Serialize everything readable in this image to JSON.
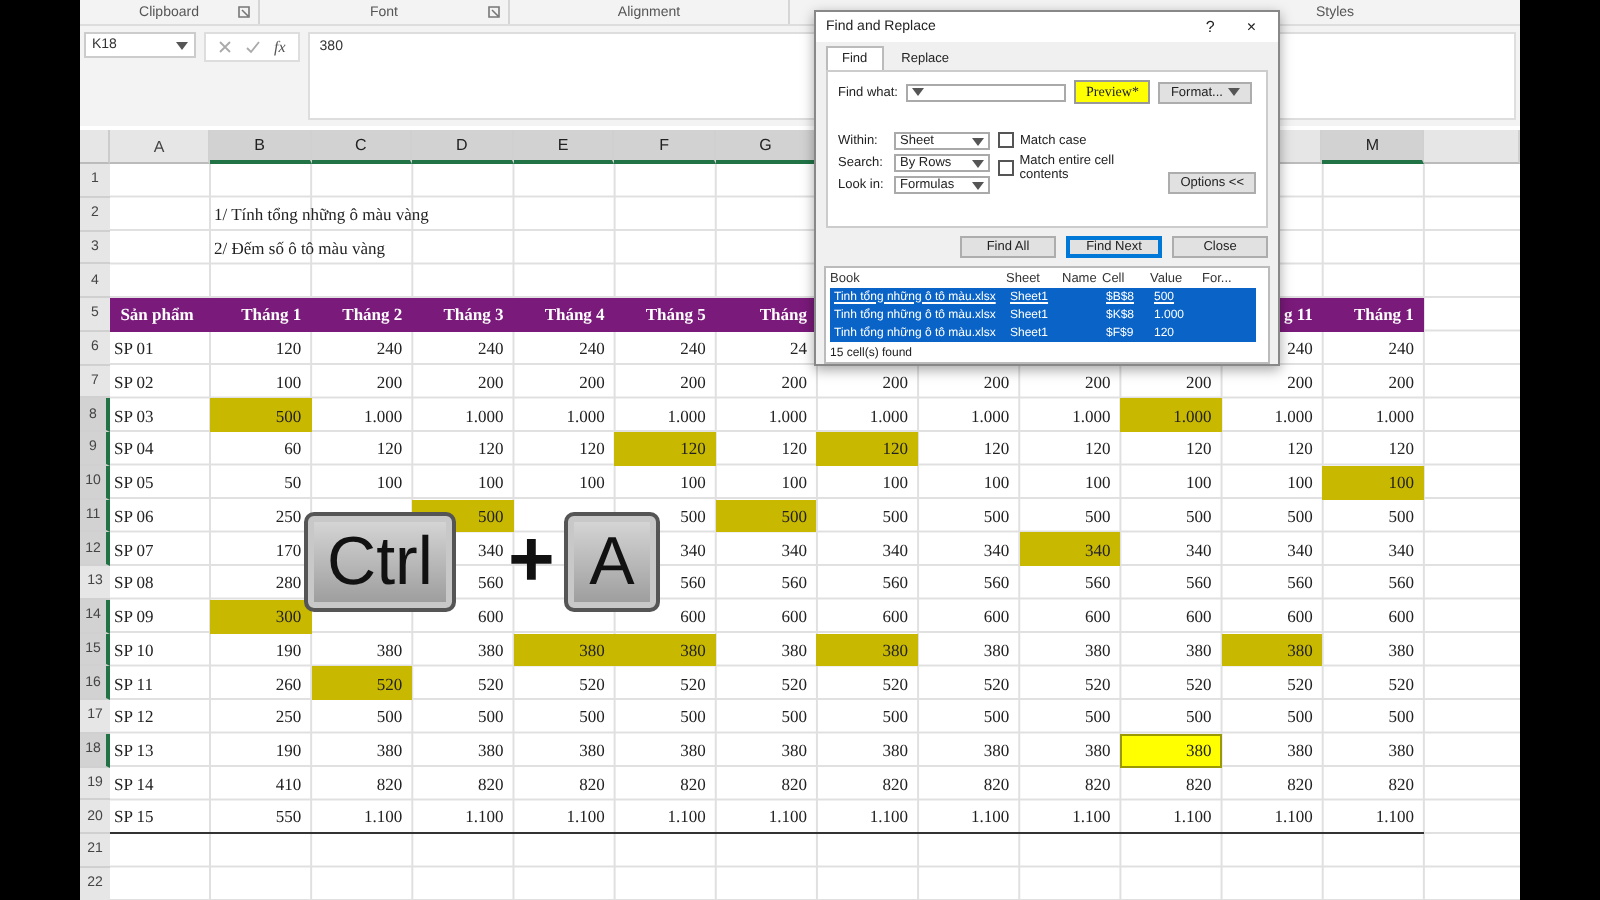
{
  "ribbon_groups": [
    {
      "label": "Clipboard",
      "launcher": true
    },
    {
      "label": "Font",
      "launcher": true
    },
    {
      "label": "Alignment",
      "launcher": false
    },
    {
      "label": "Styles",
      "launcher": false
    }
  ],
  "formula_bar": {
    "name_box": "K18",
    "function_label": "fx",
    "value": "380"
  },
  "columns": [
    {
      "label": "A",
      "selected": false
    },
    {
      "label": "B",
      "selected": true
    },
    {
      "label": "C",
      "selected": true
    },
    {
      "label": "D",
      "selected": true
    },
    {
      "label": "E",
      "selected": true
    },
    {
      "label": "F",
      "selected": true
    },
    {
      "label": "G",
      "selected": true
    },
    {},
    {},
    {},
    {},
    {
      "selected": false
    },
    {
      "label": "M",
      "selected": true
    },
    {
      "selected": false
    }
  ],
  "rows": [
    {
      "header": "1",
      "selected": false,
      "kind": "plain",
      "cells": []
    },
    {
      "header": "2",
      "selected": false,
      "kind": "plain",
      "cells": [
        null,
        {
          "text": "1/ Tính tổng những ô màu vàng"
        }
      ]
    },
    {
      "header": "3",
      "selected": false,
      "kind": "plain",
      "cells": [
        null,
        {
          "text": "2/ Đếm số ô tô màu vàng"
        }
      ]
    },
    {
      "header": "4",
      "selected": false,
      "kind": "plain",
      "cells": []
    },
    {
      "header": "5",
      "selected": false,
      "kind": "table_header",
      "cells": [
        {
          "text": "Sản phẩm"
        },
        {
          "text": "Tháng 1"
        },
        {
          "text": "Tháng 2"
        },
        {
          "text": "Tháng 3"
        },
        {
          "text": "Tháng 4"
        },
        {
          "text": "Tháng 5"
        },
        {
          "text": "Tháng"
        },
        null,
        null,
        null,
        null,
        {
          "text": "g 11"
        },
        {
          "text": "Tháng 1"
        }
      ]
    },
    {
      "header": "6",
      "selected": false,
      "kind": "data",
      "cells": [
        {
          "text": "SP 01"
        },
        {
          "text": "120"
        },
        {
          "text": "240"
        },
        {
          "text": "240"
        },
        {
          "text": "240"
        },
        {
          "text": "240"
        },
        {
          "text": "24"
        },
        null,
        null,
        null,
        null,
        {
          "text": "240"
        },
        {
          "text": "240"
        }
      ]
    },
    {
      "header": "7",
      "selected": false,
      "kind": "data",
      "cells": [
        {
          "text": "SP 02"
        },
        {
          "text": "100"
        },
        {
          "text": "200"
        },
        {
          "text": "200"
        },
        {
          "text": "200"
        },
        {
          "text": "200"
        },
        {
          "text": "200"
        },
        {
          "text": "200"
        },
        {
          "text": "200"
        },
        {
          "text": "200"
        },
        {
          "text": "200"
        },
        {
          "text": "200"
        },
        {
          "text": "200"
        }
      ]
    },
    {
      "header": "8",
      "selected": true,
      "kind": "data",
      "cells": [
        {
          "text": "SP 03"
        },
        {
          "text": "500",
          "color": "#c9b800"
        },
        {
          "text": "1.000"
        },
        {
          "text": "1.000"
        },
        {
          "text": "1.000"
        },
        {
          "text": "1.000"
        },
        {
          "text": "1.000"
        },
        {
          "text": "1.000"
        },
        {
          "text": "1.000"
        },
        {
          "text": "1.000"
        },
        {
          "text": "1.000",
          "color": "#c9b800"
        },
        {
          "text": "1.000"
        },
        {
          "text": "1.000"
        }
      ]
    },
    {
      "header": "9",
      "selected": true,
      "kind": "data",
      "cells": [
        {
          "text": "SP 04"
        },
        {
          "text": "60"
        },
        {
          "text": "120"
        },
        {
          "text": "120"
        },
        {
          "text": "120"
        },
        {
          "text": "120",
          "color": "#c9b800"
        },
        {
          "text": "120"
        },
        {
          "text": "120",
          "color": "#c9b800"
        },
        {
          "text": "120"
        },
        {
          "text": "120"
        },
        {
          "text": "120"
        },
        {
          "text": "120"
        },
        {
          "text": "120"
        }
      ]
    },
    {
      "header": "10",
      "selected": true,
      "kind": "data",
      "cells": [
        {
          "text": "SP 05"
        },
        {
          "text": "50"
        },
        {
          "text": "100"
        },
        {
          "text": "100"
        },
        {
          "text": "100"
        },
        {
          "text": "100"
        },
        {
          "text": "100"
        },
        {
          "text": "100"
        },
        {
          "text": "100"
        },
        {
          "text": "100"
        },
        {
          "text": "100"
        },
        {
          "text": "100"
        },
        {
          "text": "100",
          "color": "#c9b800"
        }
      ]
    },
    {
      "header": "11",
      "selected": true,
      "kind": "data",
      "cells": [
        {
          "text": "SP 06"
        },
        {
          "text": "250"
        },
        null,
        {
          "text": "500",
          "color": "#c9b800"
        },
        null,
        {
          "text": "500"
        },
        {
          "text": "500",
          "color": "#c9b800"
        },
        {
          "text": "500"
        },
        {
          "text": "500"
        },
        {
          "text": "500"
        },
        {
          "text": "500"
        },
        {
          "text": "500"
        },
        {
          "text": "500"
        }
      ]
    },
    {
      "header": "12",
      "selected": true,
      "kind": "data",
      "cells": [
        {
          "text": "SP 07"
        },
        {
          "text": "170"
        },
        null,
        {
          "text": "340"
        },
        null,
        {
          "text": "340"
        },
        {
          "text": "340"
        },
        {
          "text": "340"
        },
        {
          "text": "340"
        },
        {
          "text": "340",
          "color": "#c9b800"
        },
        {
          "text": "340"
        },
        {
          "text": "340"
        },
        {
          "text": "340"
        }
      ]
    },
    {
      "header": "13",
      "selected": false,
      "kind": "data",
      "cells": [
        {
          "text": "SP 08"
        },
        {
          "text": "280"
        },
        null,
        {
          "text": "560"
        },
        null,
        {
          "text": "560"
        },
        {
          "text": "560"
        },
        {
          "text": "560"
        },
        {
          "text": "560"
        },
        {
          "text": "560"
        },
        {
          "text": "560"
        },
        {
          "text": "560"
        },
        {
          "text": "560"
        }
      ]
    },
    {
      "header": "14",
      "selected": true,
      "kind": "data",
      "cells": [
        {
          "text": "SP 09"
        },
        {
          "text": "300",
          "color": "#c9b800"
        },
        null,
        {
          "text": "600"
        },
        null,
        {
          "text": "600"
        },
        {
          "text": "600"
        },
        {
          "text": "600"
        },
        {
          "text": "600"
        },
        {
          "text": "600"
        },
        {
          "text": "600"
        },
        {
          "text": "600"
        },
        {
          "text": "600"
        }
      ]
    },
    {
      "header": "15",
      "selected": true,
      "kind": "data",
      "cells": [
        {
          "text": "SP 10"
        },
        {
          "text": "190"
        },
        {
          "text": "380"
        },
        {
          "text": "380"
        },
        {
          "text": "380",
          "color": "#c9b800"
        },
        {
          "text": "380",
          "color": "#c9b800"
        },
        {
          "text": "380"
        },
        {
          "text": "380",
          "color": "#c9b800"
        },
        {
          "text": "380"
        },
        {
          "text": "380"
        },
        {
          "text": "380"
        },
        {
          "text": "380",
          "color": "#c9b800"
        },
        {
          "text": "380"
        }
      ]
    },
    {
      "header": "16",
      "selected": true,
      "kind": "data",
      "cells": [
        {
          "text": "SP 11"
        },
        {
          "text": "260"
        },
        {
          "text": "520",
          "color": "#c9b800"
        },
        {
          "text": "520"
        },
        {
          "text": "520"
        },
        {
          "text": "520"
        },
        {
          "text": "520"
        },
        {
          "text": "520"
        },
        {
          "text": "520"
        },
        {
          "text": "520"
        },
        {
          "text": "520"
        },
        {
          "text": "520"
        },
        {
          "text": "520"
        }
      ]
    },
    {
      "header": "17",
      "selected": false,
      "kind": "data",
      "cells": [
        {
          "text": "SP 12"
        },
        {
          "text": "250"
        },
        {
          "text": "500"
        },
        {
          "text": "500"
        },
        {
          "text": "500"
        },
        {
          "text": "500"
        },
        {
          "text": "500"
        },
        {
          "text": "500"
        },
        {
          "text": "500"
        },
        {
          "text": "500"
        },
        {
          "text": "500"
        },
        {
          "text": "500"
        },
        {
          "text": "500"
        }
      ]
    },
    {
      "header": "18",
      "selected": true,
      "kind": "data",
      "cells": [
        {
          "text": "SP 13"
        },
        {
          "text": "190"
        },
        {
          "text": "380"
        },
        {
          "text": "380"
        },
        {
          "text": "380"
        },
        {
          "text": "380"
        },
        {
          "text": "380"
        },
        {
          "text": "380"
        },
        {
          "text": "380"
        },
        {
          "text": "380"
        },
        {
          "text": "380",
          "color": "#ffff00",
          "active": true
        },
        {
          "text": "380"
        },
        {
          "text": "380"
        }
      ]
    },
    {
      "header": "19",
      "selected": false,
      "kind": "data",
      "cells": [
        {
          "text": "SP 14"
        },
        {
          "text": "410"
        },
        {
          "text": "820"
        },
        {
          "text": "820"
        },
        {
          "text": "820"
        },
        {
          "text": "820"
        },
        {
          "text": "820"
        },
        {
          "text": "820"
        },
        {
          "text": "820"
        },
        {
          "text": "820"
        },
        {
          "text": "820"
        },
        {
          "text": "820"
        },
        {
          "text": "820"
        }
      ]
    },
    {
      "header": "20",
      "selected": false,
      "kind": "data",
      "cells": [
        {
          "text": "SP 15"
        },
        {
          "text": "550"
        },
        {
          "text": "1.100"
        },
        {
          "text": "1.100"
        },
        {
          "text": "1.100"
        },
        {
          "text": "1.100"
        },
        {
          "text": "1.100"
        },
        {
          "text": "1.100"
        },
        {
          "text": "1.100"
        },
        {
          "text": "1.100"
        },
        {
          "text": "1.100"
        },
        {
          "text": "1.100"
        },
        {
          "text": "1.100"
        }
      ]
    },
    {
      "header": "21",
      "selected": false,
      "kind": "plain",
      "cells": []
    },
    {
      "header": "22",
      "selected": false,
      "kind": "plain",
      "cells": []
    }
  ],
  "dialog": {
    "title": "Find and Replace",
    "help": "?",
    "close": "×",
    "tabs": [
      {
        "label": "Find",
        "selected": true
      },
      {
        "label": "Replace",
        "selected": false
      }
    ],
    "find_what": {
      "label": "Find what:",
      "preview": "Preview*",
      "format_button": "Format..."
    },
    "options": [
      {
        "label": "Within:",
        "value": "Sheet"
      },
      {
        "label": "Search:",
        "value": "By Rows"
      },
      {
        "label": "Look in:",
        "value": "Formulas"
      }
    ],
    "checkboxes": [
      {
        "label": "Match case",
        "checked": false
      },
      {
        "label": "Match entire cell contents",
        "checked": false
      }
    ],
    "options_button": "Options <<",
    "buttons": [
      {
        "label": "Find All",
        "default": false
      },
      {
        "label": "Find Next",
        "default": true
      },
      {
        "label": "Close",
        "default": false
      }
    ],
    "results": {
      "columns": [
        "Book",
        "Sheet",
        "Name",
        "Cell",
        "Value",
        "For..."
      ],
      "rows": [
        {
          "book": "Tinh tổng những ô tô màu.xlsx",
          "sheet": "Sheet1",
          "cell": "$B$8",
          "value": "500",
          "selected": true
        },
        {
          "book": "Tinh tổng những ô tô màu.xlsx",
          "sheet": "Sheet1",
          "cell": "$K$8",
          "value": "1.000",
          "selected": true
        },
        {
          "book": "Tinh tổng những ô tô màu.xlsx",
          "sheet": "Sheet1",
          "cell": "$F$9",
          "value": "120",
          "selected": true
        }
      ],
      "status": "15 cell(s) found"
    }
  },
  "shortcut": {
    "keys": [
      "Ctrl",
      "A"
    ],
    "joiner": "+"
  }
}
